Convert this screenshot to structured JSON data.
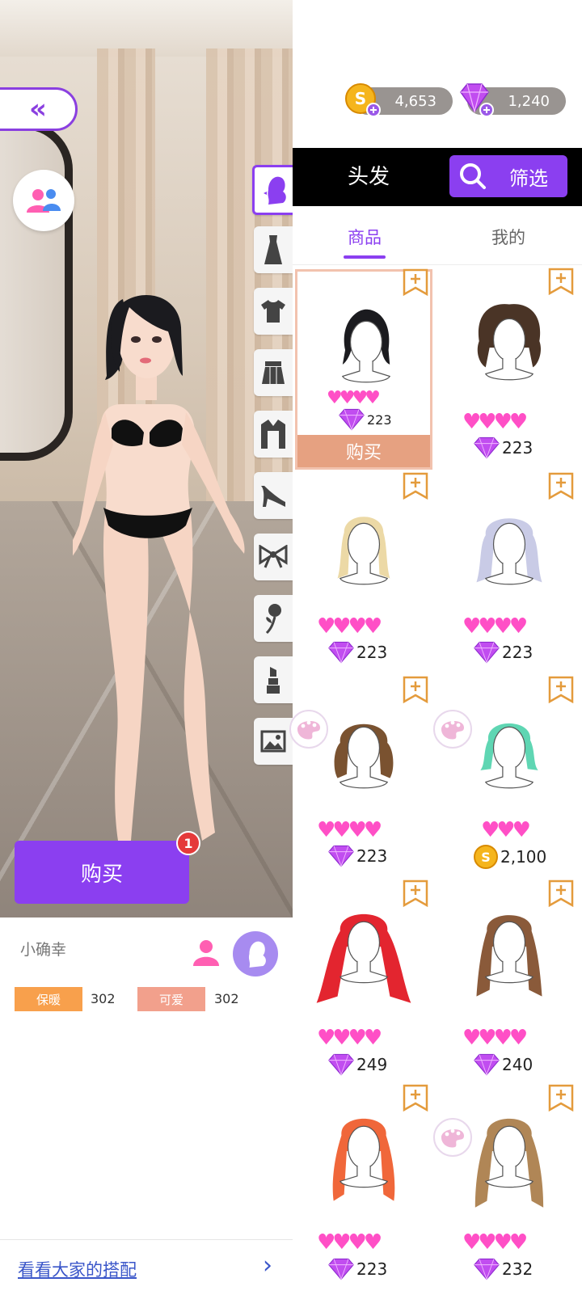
{
  "currency": {
    "coins": "4,653",
    "gems": "1,240"
  },
  "panel": {
    "title": "头发",
    "filter_label": "筛选",
    "tabs": [
      {
        "label": "商品",
        "active": true
      },
      {
        "label": "我的",
        "active": false
      }
    ]
  },
  "categories": [
    "hair",
    "dress",
    "top",
    "skirt",
    "coat",
    "shoes",
    "accessory",
    "handheld",
    "makeup",
    "background"
  ],
  "items": [
    {
      "hearts": 4,
      "price": "223",
      "currency": "gem",
      "palette": false,
      "selected": true,
      "buy_label": "购买",
      "hair_color": "#1b1b1f"
    },
    {
      "hearts": 4,
      "price": "223",
      "currency": "gem",
      "palette": false,
      "selected": false,
      "hair_color": "#4a3426"
    },
    {
      "hearts": 4,
      "price": "223",
      "currency": "gem",
      "palette": false,
      "selected": false,
      "hair_color": "#ecd9a6"
    },
    {
      "hearts": 4,
      "price": "223",
      "currency": "gem",
      "palette": false,
      "selected": false,
      "hair_color": "#c9cbe6"
    },
    {
      "hearts": 4,
      "price": "223",
      "currency": "gem",
      "palette": true,
      "selected": false,
      "hair_color": "#7a5230"
    },
    {
      "hearts": 3,
      "price": "2,100",
      "currency": "coin",
      "palette": true,
      "selected": false,
      "hair_color": "#5fd6b3"
    },
    {
      "hearts": 4,
      "price": "249",
      "currency": "gem",
      "palette": false,
      "selected": false,
      "hair_color": "#e3252f"
    },
    {
      "hearts": 4,
      "price": "240",
      "currency": "gem",
      "palette": false,
      "selected": false,
      "hair_color": "#8a5a3a"
    },
    {
      "hearts": 4,
      "price": "223",
      "currency": "gem",
      "palette": false,
      "selected": false,
      "hair_color": "#f0673a"
    },
    {
      "hearts": 4,
      "price": "232",
      "currency": "gem",
      "palette": true,
      "selected": false,
      "hair_color": "#b08656"
    }
  ],
  "left": {
    "buy_label": "购买",
    "buy_badge": "1",
    "outfit_name": "小确幸",
    "stats": [
      {
        "label": "保暖",
        "value": "302",
        "color": "#f8a04c"
      },
      {
        "label": "可爱",
        "value": "302",
        "color": "#f2a08c"
      }
    ],
    "see_others_link": "看看大家的搭配"
  },
  "colors": {
    "accent": "#8b3ff0",
    "heart": "#ff4fc6",
    "buy_strip": "#e6a181"
  }
}
